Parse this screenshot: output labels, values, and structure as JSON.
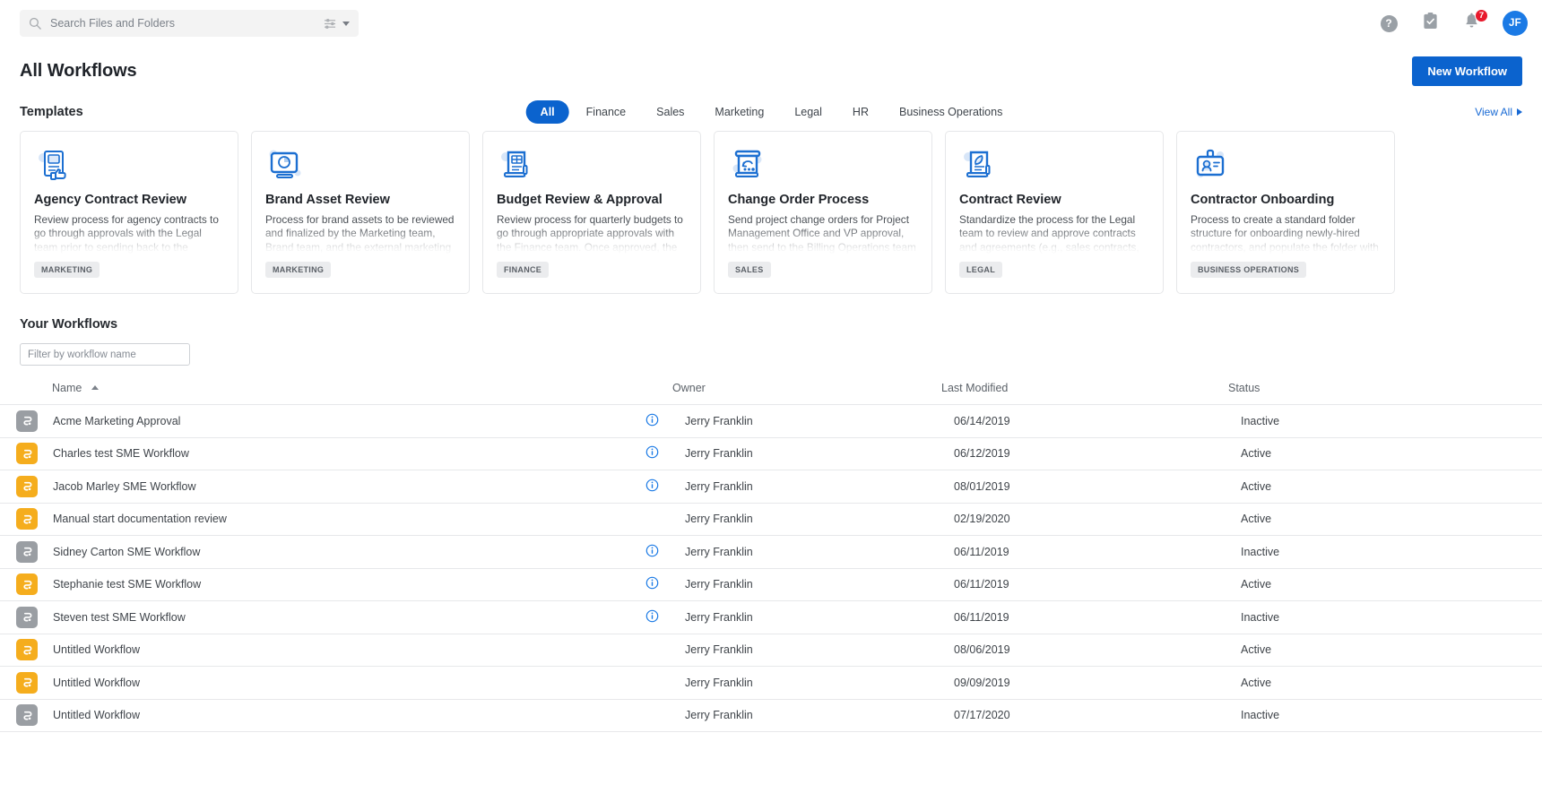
{
  "topbar": {
    "search_placeholder": "Search Files and Folders",
    "search_value": "",
    "search_icon": "search-icon",
    "filter_icon": "search-filter-icon",
    "help_label": "?",
    "tasks_icon": "clipboard-check-icon",
    "notifications_icon": "bell-icon",
    "notification_count": "7",
    "avatar_initials": "JF"
  },
  "header": {
    "title": "All Workflows",
    "new_workflow_label": "New Workflow"
  },
  "templates": {
    "section_title": "Templates",
    "view_all_label": "View All",
    "tabs": [
      {
        "label": "All",
        "active": true
      },
      {
        "label": "Finance",
        "active": false
      },
      {
        "label": "Sales",
        "active": false
      },
      {
        "label": "Marketing",
        "active": false
      },
      {
        "label": "Legal",
        "active": false
      },
      {
        "label": "HR",
        "active": false
      },
      {
        "label": "Business Operations",
        "active": false
      }
    ],
    "cards": [
      {
        "title": "Agency Contract Review",
        "description": "Review process for agency contracts to go through approvals with the Legal team prior to sending back to the marketing manager to",
        "tag": "MARKETING",
        "icon": "document-image-thumbsup-icon"
      },
      {
        "title": "Brand Asset Review",
        "description": "Process for brand assets to be reviewed and finalized by the Marketing team, Brand team, and the external marketing agency.",
        "tag": "MARKETING",
        "icon": "monitor-chart-icon"
      },
      {
        "title": "Budget Review & Approval",
        "description": "Review process for quarterly budgets to go through appropriate approvals with the Finance team. Once approved, the Accounting",
        "tag": "FINANCE",
        "icon": "scroll-table-icon"
      },
      {
        "title": "Change Order Process",
        "description": "Send project change orders for Project Management Office and VP approval, then send to the Billing Operations team for",
        "tag": "SALES",
        "icon": "scroll-change-icon"
      },
      {
        "title": "Contract Review",
        "description": "Standardize the process for the Legal team to review and approve contracts and agreements (e.g., sales contracts, NDAs) prior to external",
        "tag": "LEGAL",
        "icon": "scroll-quill-icon"
      },
      {
        "title": "Contractor Onboarding",
        "description": "Process to create a standard folder structure for onboarding newly-hired contractors, and populate the folder with commonly used",
        "tag": "BUSINESS OPERATIONS",
        "icon": "id-badge-icon"
      }
    ]
  },
  "your_workflows": {
    "section_title": "Your Workflows",
    "filter_placeholder": "Filter by workflow name",
    "filter_value": "",
    "columns": {
      "name": "Name",
      "owner": "Owner",
      "last_modified": "Last Modified",
      "status": "Status"
    },
    "sort": {
      "column": "Name",
      "direction": "asc"
    },
    "rows": [
      {
        "name": "Acme Marketing Approval",
        "has_info": true,
        "owner": "Jerry Franklin",
        "last_modified": "06/14/2019",
        "status": "Inactive"
      },
      {
        "name": "Charles test SME Workflow",
        "has_info": true,
        "owner": "Jerry Franklin",
        "last_modified": "06/12/2019",
        "status": "Active"
      },
      {
        "name": "Jacob Marley SME Workflow",
        "has_info": true,
        "owner": "Jerry Franklin",
        "last_modified": "08/01/2019",
        "status": "Active"
      },
      {
        "name": "Manual start documentation review",
        "has_info": false,
        "owner": "Jerry Franklin",
        "last_modified": "02/19/2020",
        "status": "Active"
      },
      {
        "name": "Sidney Carton SME Workflow",
        "has_info": true,
        "owner": "Jerry Franklin",
        "last_modified": "06/11/2019",
        "status": "Inactive"
      },
      {
        "name": "Stephanie test SME Workflow",
        "has_info": true,
        "owner": "Jerry Franklin",
        "last_modified": "06/11/2019",
        "status": "Active"
      },
      {
        "name": "Steven test SME Workflow",
        "has_info": true,
        "owner": "Jerry Franklin",
        "last_modified": "06/11/2019",
        "status": "Inactive"
      },
      {
        "name": "Untitled Workflow",
        "has_info": false,
        "owner": "Jerry Franklin",
        "last_modified": "08/06/2019",
        "status": "Active"
      },
      {
        "name": "Untitled Workflow",
        "has_info": false,
        "owner": "Jerry Franklin",
        "last_modified": "09/09/2019",
        "status": "Active"
      },
      {
        "name": "Untitled Workflow",
        "has_info": false,
        "owner": "Jerry Franklin",
        "last_modified": "07/17/2020",
        "status": "Inactive"
      }
    ]
  },
  "colors": {
    "accent_blue": "#0b63ce",
    "link_blue": "#1769d4",
    "active_amber": "#f5ad1d",
    "inactive_gray": "#9a9ea3",
    "badge_red": "#e8192c",
    "avatar_blue": "#1b7ae5"
  }
}
